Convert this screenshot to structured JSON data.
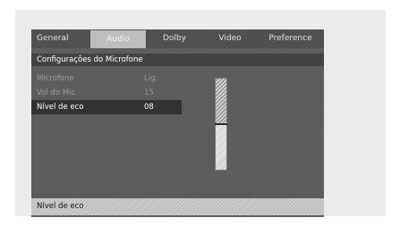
{
  "tabs": [
    {
      "label": "General",
      "active": false
    },
    {
      "label": "Audio",
      "active": true
    },
    {
      "label": "Dolby",
      "active": false
    },
    {
      "label": "Video",
      "active": false
    },
    {
      "label": "Preference",
      "active": false
    }
  ],
  "section_title": "Configurações do Microfone",
  "menu": [
    {
      "label": "Microfone",
      "value": "Lig.",
      "selected": false
    },
    {
      "label": "Vol do Mic",
      "value": "15",
      "selected": false
    },
    {
      "label": "Nível de eco",
      "value": "08",
      "selected": true
    }
  ],
  "slider": {
    "level": 0.5
  },
  "status_text": "Nível de eco",
  "colors": {
    "panel": "#5a5a5a",
    "tab_bar": "#4a4a4a",
    "tab_active": "#bdbdbd",
    "selected_row": "#2e2e2e",
    "status_bar": "#bdbdbd"
  }
}
